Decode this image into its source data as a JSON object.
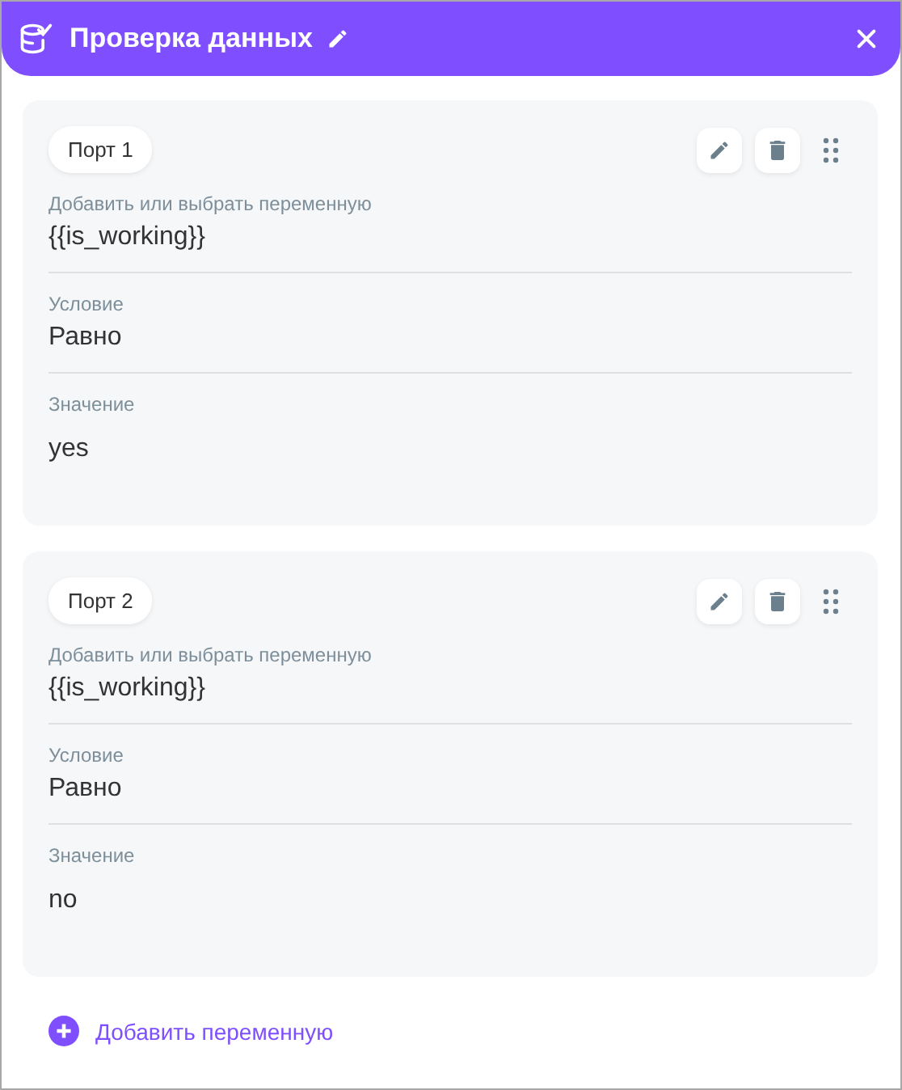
{
  "header": {
    "title": "Проверка данных"
  },
  "ports": [
    {
      "name": "Порт 1",
      "fields": [
        {
          "label": "Добавить или выбрать переменную",
          "value": "{{is_working}}"
        },
        {
          "label": "Условие",
          "value": "Равно"
        },
        {
          "label": "Значение",
          "value": "yes"
        }
      ]
    },
    {
      "name": "Порт 2",
      "fields": [
        {
          "label": "Добавить или выбрать переменную",
          "value": "{{is_working}}"
        },
        {
          "label": "Условие",
          "value": "Равно"
        },
        {
          "label": "Значение",
          "value": "no"
        }
      ]
    }
  ],
  "add_button": {
    "label": "Добавить переменную"
  }
}
